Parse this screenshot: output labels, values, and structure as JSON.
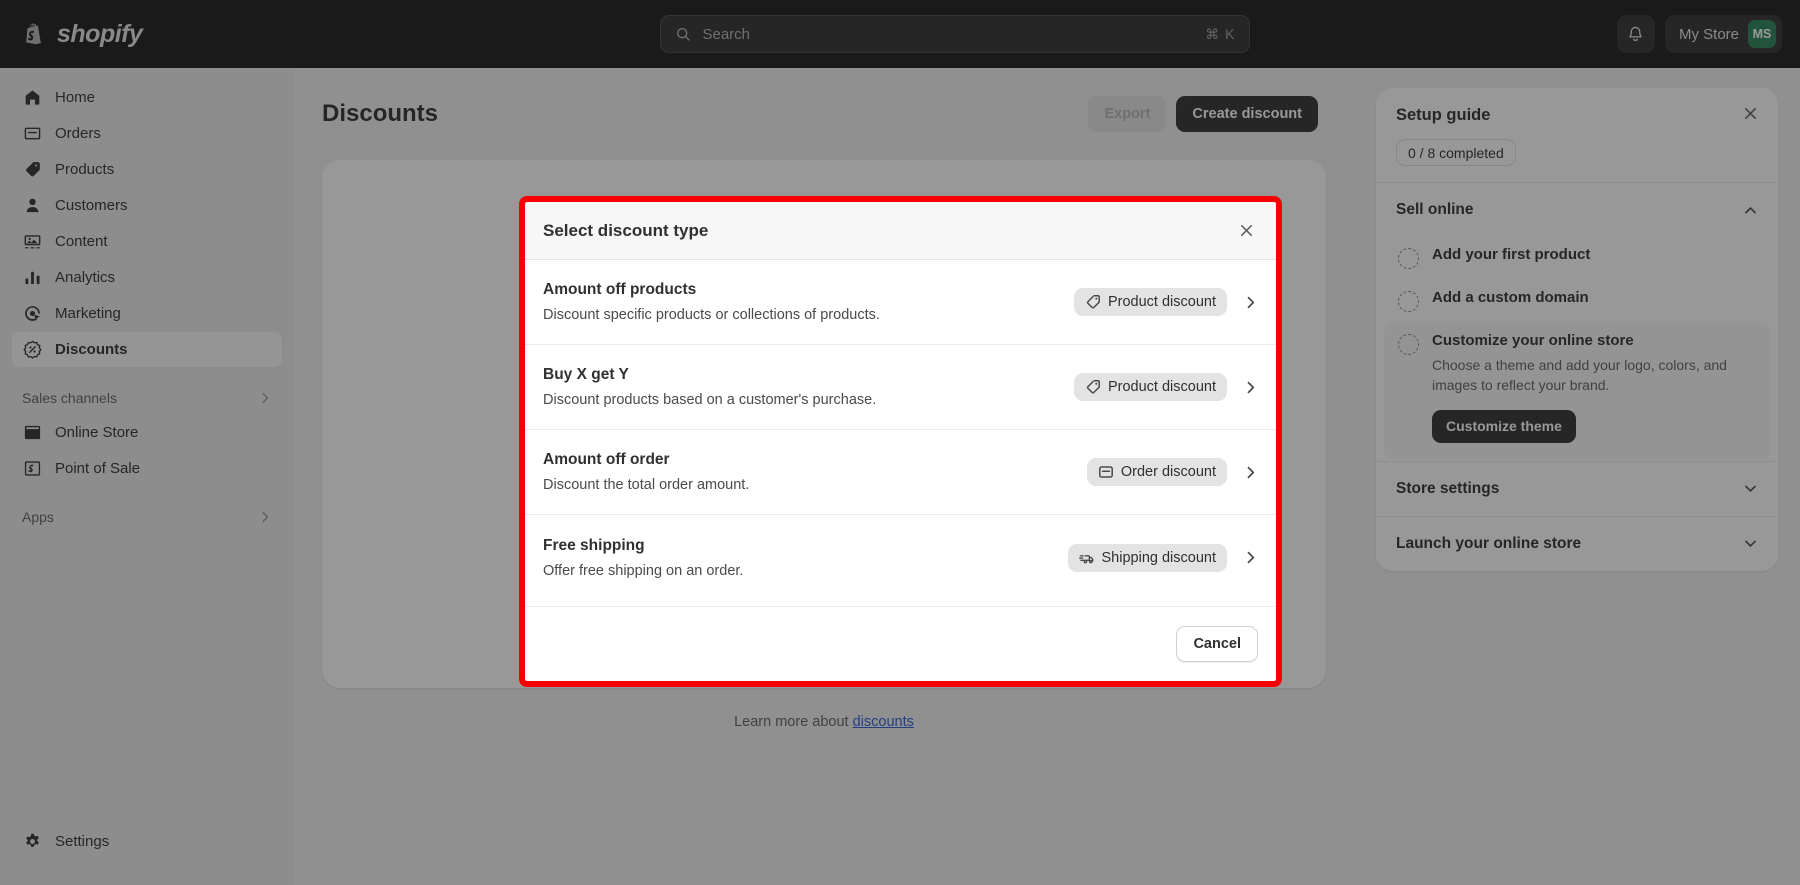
{
  "topbar": {
    "brand": "shopify",
    "brand_icon": "shopify-bag-icon",
    "search": {
      "placeholder": "Search",
      "shortcut": "⌘ K",
      "icon": "search-icon"
    },
    "notifications_icon": "bell-icon",
    "store_name": "My Store",
    "avatar_initials": "MS",
    "avatar_color": "#29845a"
  },
  "sidebar": {
    "items": [
      {
        "label": "Home",
        "icon": "home-icon"
      },
      {
        "label": "Orders",
        "icon": "orders-inbox-icon"
      },
      {
        "label": "Products",
        "icon": "product-tag-icon"
      },
      {
        "label": "Customers",
        "icon": "person-icon"
      },
      {
        "label": "Content",
        "icon": "content-image-icon"
      },
      {
        "label": "Analytics",
        "icon": "bar-chart-icon"
      },
      {
        "label": "Marketing",
        "icon": "marketing-target-icon"
      },
      {
        "label": "Discounts",
        "icon": "discount-percent-icon"
      }
    ],
    "sales_channels": {
      "label": "Sales channels",
      "icon": "chevron-right-icon"
    },
    "channels": [
      {
        "label": "Online Store",
        "icon": "storefront-icon"
      },
      {
        "label": "Point of Sale",
        "icon": "pos-bag-icon"
      }
    ],
    "apps": {
      "label": "Apps",
      "icon": "chevron-right-icon"
    },
    "settings": {
      "label": "Settings",
      "icon": "gear-icon"
    }
  },
  "main": {
    "page_title": "Discounts",
    "export_label": "Export",
    "create_label": "Create discount",
    "learn_prefix": "Learn more about ",
    "learn_link": "discounts"
  },
  "setup_guide": {
    "title": "Setup guide",
    "close_icon": "close-icon",
    "progress": "0 / 8 completed",
    "groups": [
      {
        "title": "Sell online",
        "chevron": "chevron-up-icon",
        "tasks": [
          {
            "label": "Add your first product",
            "desc": "",
            "expanded": false
          },
          {
            "label": "Add a custom domain",
            "desc": "",
            "expanded": false
          },
          {
            "label": "Customize your online store",
            "desc": "Choose a theme and add your logo, colors, and images to reflect your brand.",
            "expanded": true,
            "action": "Customize theme"
          }
        ]
      },
      {
        "title": "Store settings",
        "chevron": "chevron-down-icon",
        "tasks": []
      },
      {
        "title": "Launch your online store",
        "chevron": "chevron-down-icon",
        "tasks": []
      }
    ]
  },
  "modal": {
    "title": "Select discount type",
    "close_icon": "close-icon",
    "highlight_color": "#f60000",
    "options": [
      {
        "title": "Amount off products",
        "desc": "Discount specific products or collections of products.",
        "badge": "Product discount",
        "badge_icon": "price-tag-icon",
        "chevron": "chevron-right-icon"
      },
      {
        "title": "Buy X get Y",
        "desc": "Discount products based on a customer's purchase.",
        "badge": "Product discount",
        "badge_icon": "price-tag-icon",
        "chevron": "chevron-right-icon"
      },
      {
        "title": "Amount off order",
        "desc": "Discount the total order amount.",
        "badge": "Order discount",
        "badge_icon": "order-inbox-icon",
        "chevron": "chevron-right-icon"
      },
      {
        "title": "Free shipping",
        "desc": "Offer free shipping on an order.",
        "badge": "Shipping discount",
        "badge_icon": "delivery-truck-icon",
        "chevron": "chevron-right-icon"
      }
    ],
    "cancel_label": "Cancel"
  }
}
